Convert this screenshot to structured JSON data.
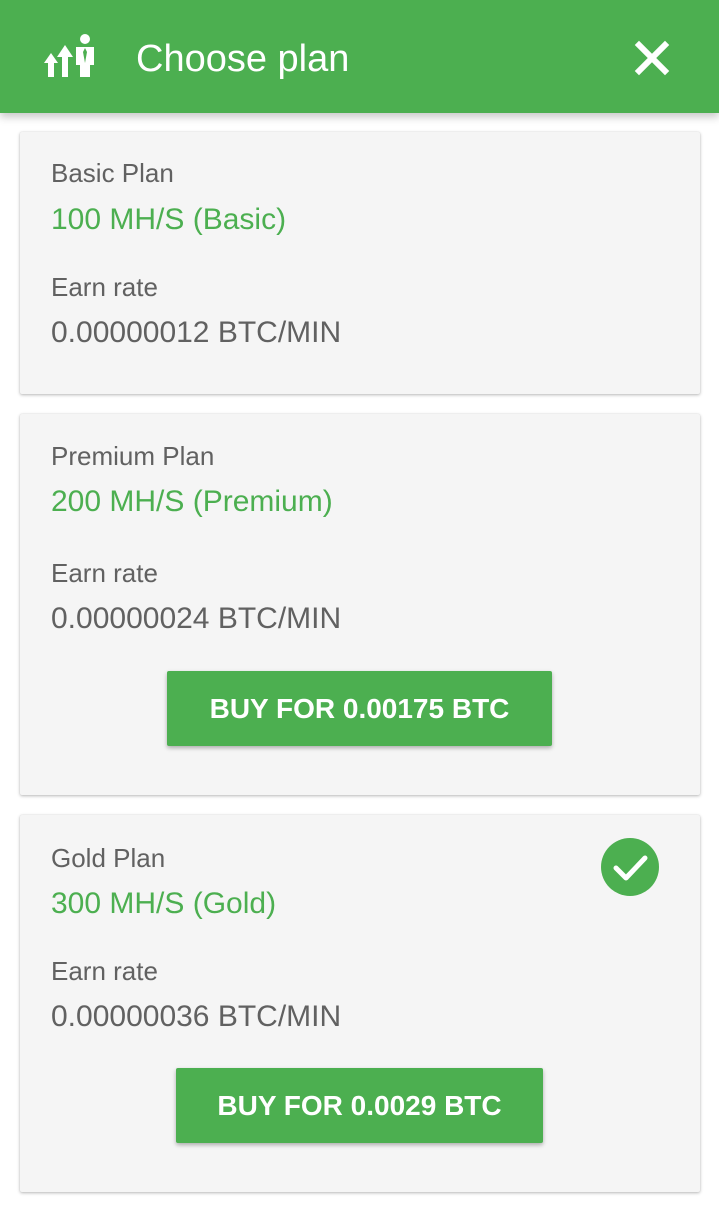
{
  "header": {
    "title": "Choose plan",
    "logo_icon": "upgrade-person-icon",
    "close_icon": "close-icon",
    "color": "#4caf50"
  },
  "plans": [
    {
      "name": "Basic Plan",
      "speed": "100 MH/S (Basic)",
      "earn_rate_label": "Earn rate",
      "earn_rate": "0.00000012 BTC/MIN",
      "button_label": ""
    },
    {
      "name": "Premium Plan",
      "speed": "200 MH/S (Premium)",
      "earn_rate_label": "Earn rate",
      "earn_rate": "0.00000024 BTC/MIN",
      "button_label": "BUY FOR 0.00175 BTC"
    },
    {
      "name": "Gold Plan",
      "speed": "300 MH/S (Gold)",
      "earn_rate_label": "Earn rate",
      "earn_rate": "0.00000036 BTC/MIN",
      "button_label": "BUY FOR 0.0029 BTC",
      "selected_icon": "check-circle-icon"
    }
  ],
  "colors": {
    "accent": "#4caf50",
    "card_bg": "#f5f5f5",
    "text_secondary": "#616161"
  }
}
